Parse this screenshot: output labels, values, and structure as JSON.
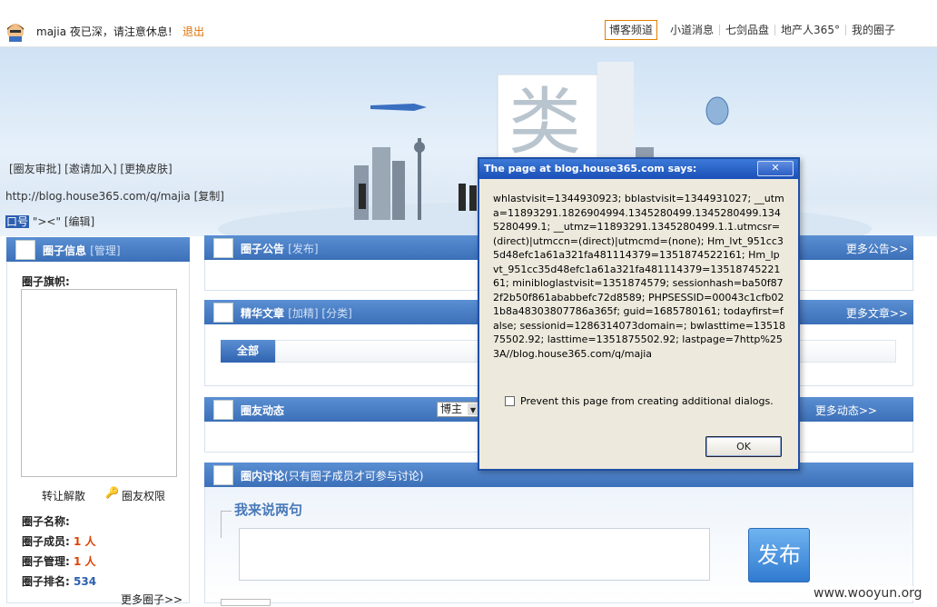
{
  "topbar": {
    "greeting": "majia 夜已深，请注意休息!",
    "logout": "退出",
    "nav": [
      "博客频道",
      "小道消息",
      "七剑品盘",
      "地产人365°",
      "我的圈子"
    ]
  },
  "banner": {
    "links": "[圈友审批] [邀请加入] [更换皮肤]",
    "url": "http://blog.house365.com/q/majia",
    "copy": "[复制]",
    "slogan_prefix": "口号",
    "slogan_text": "\"><\"",
    "edit": "[编辑]"
  },
  "left_panel": {
    "title": "圈子信息",
    "manage": "[管理]",
    "flag_label": "圈子旗帜:",
    "transfer": "转让解散",
    "rights": "圈友权限",
    "name_label": "圈子名称:",
    "members_label": "圈子成员:",
    "members_value": "1 人",
    "admin_label": "圈子管理:",
    "admin_value": "1 人",
    "rank_label": "圈子排名:",
    "rank_value": "534",
    "more": "更多圈子>>"
  },
  "notice": {
    "title": "圈子公告",
    "action": "[发布]",
    "more": "更多公告>>"
  },
  "essence": {
    "title": "精华文章",
    "actions": "[加精] [分类]",
    "more": "更多文章>>",
    "tab_all": "全部"
  },
  "activity": {
    "title": "圈友动态",
    "select": "博主",
    "more": "更多动态>>"
  },
  "discussion": {
    "title": "圈内讨论",
    "note": "(只有圈子成员才可参与讨论)",
    "compose_label": "我来说两句",
    "post_button": "发布"
  },
  "dialog": {
    "title": "The page at blog.house365.com says:",
    "close": "✕",
    "message": "whlastvisit=1344930923; bblastvisit=1344931027; __utma=11893291.1826904994.1345280499.1345280499.1345280499.1; __utmz=11893291.1345280499.1.1.utmcsr=(direct)|utmccn=(direct)|utmcmd=(none); Hm_lvt_951cc35d48efc1a61a321fa481114379=1351874522161; Hm_lpvt_951cc35d48efc1a61a321fa481114379=1351874522161; minibloglastvisit=1351874579; sessionhash=ba50f872f2b50f861ababbefc72d8589; PHPSESSID=00043c1cfb021b8a48303807786a365f; guid=1685780161; todayfirst=false; sessionid=1286314073domain=; bwlasttime=1351875502.92; lasttime=1351875502.92; lastpage=7http%253A//blog.house365.com/q/majia",
    "checkbox_label": "Prevent this page from creating additional dialogs.",
    "ok": "OK"
  },
  "watermark": "www.wooyun.org"
}
